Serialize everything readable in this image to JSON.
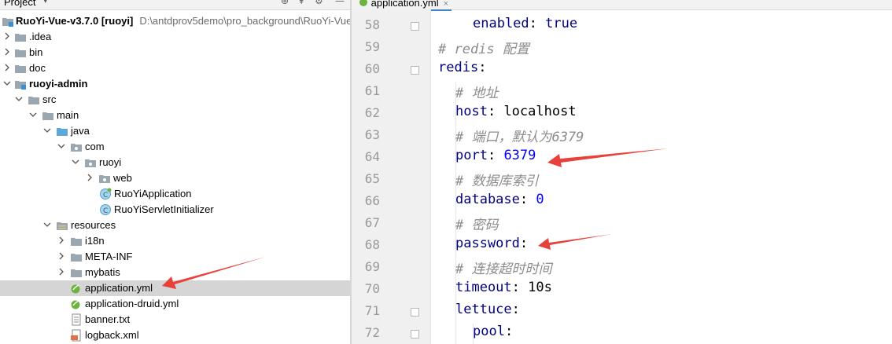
{
  "project_pane": {
    "title": "Project",
    "tree": [
      {
        "label": "RuoYi-Vue-v3.7.0",
        "module": "[ruoyi]",
        "path": "D:\\antdprov5demo\\pro_background\\RuoYi-Vue",
        "icon": "module-folder-icon",
        "arrow": "down",
        "bold": true
      },
      {
        "label": ".idea",
        "icon": "folder-icon",
        "arrow": "right"
      },
      {
        "label": "bin",
        "icon": "folder-icon",
        "arrow": "right"
      },
      {
        "label": "doc",
        "icon": "folder-icon",
        "arrow": "right"
      },
      {
        "label": "ruoyi-admin",
        "icon": "module-folder-icon",
        "arrow": "down",
        "bold": true
      },
      {
        "label": "src",
        "icon": "folder-icon",
        "arrow": "down"
      },
      {
        "label": "main",
        "icon": "folder-icon",
        "arrow": "down"
      },
      {
        "label": "java",
        "icon": "source-folder-icon",
        "arrow": "down"
      },
      {
        "label": "com",
        "icon": "package-icon",
        "arrow": "down"
      },
      {
        "label": "ruoyi",
        "icon": "package-icon",
        "arrow": "down"
      },
      {
        "label": "web",
        "icon": "package-icon",
        "arrow": "right"
      },
      {
        "label": "RuoYiApplication",
        "icon": "spring-class-icon",
        "arrow": ""
      },
      {
        "label": "RuoYiServletInitializer",
        "icon": "class-icon",
        "arrow": ""
      },
      {
        "label": "resources",
        "icon": "resources-folder-icon",
        "arrow": "down"
      },
      {
        "label": "i18n",
        "icon": "folder-icon",
        "arrow": "right"
      },
      {
        "label": "META-INF",
        "icon": "folder-icon",
        "arrow": "right"
      },
      {
        "label": "mybatis",
        "icon": "folder-icon",
        "arrow": "right"
      },
      {
        "label": "application.yml",
        "icon": "spring-yml-icon",
        "arrow": "",
        "selected": true
      },
      {
        "label": "application-druid.yml",
        "icon": "spring-yml-icon",
        "arrow": ""
      },
      {
        "label": "banner.txt",
        "icon": "text-file-icon",
        "arrow": ""
      },
      {
        "label": "logback.xml",
        "icon": "xml-file-icon",
        "arrow": ""
      }
    ]
  },
  "editor": {
    "tab_label": "application.yml",
    "tab_close": "×",
    "lines": [
      {
        "num": "58",
        "text": "enabled: true"
      },
      {
        "num": "59",
        "text": "# redis 配置"
      },
      {
        "num": "60",
        "text": "redis:"
      },
      {
        "num": "61",
        "text": "# 地址"
      },
      {
        "num": "62",
        "text": "host: localhost"
      },
      {
        "num": "63",
        "text": "# 端口，默认为6379"
      },
      {
        "num": "64",
        "text": "port: 6379"
      },
      {
        "num": "65",
        "text": "# 数据库索引"
      },
      {
        "num": "66",
        "text": "database: 0"
      },
      {
        "num": "67",
        "text": "# 密码"
      },
      {
        "num": "68",
        "text": "password:"
      },
      {
        "num": "69",
        "text": "# 连接超时时间"
      },
      {
        "num": "70",
        "text": "timeout: 10s"
      },
      {
        "num": "71",
        "text": "lettuce:"
      },
      {
        "num": "72",
        "text": "pool:"
      }
    ]
  },
  "colors": {
    "annotation_arrow": "#e8403a",
    "yaml_key": "#000080",
    "yaml_number": "#0000ff",
    "yaml_comment": "#8c8c8c",
    "selection": "#d5d5d5"
  }
}
